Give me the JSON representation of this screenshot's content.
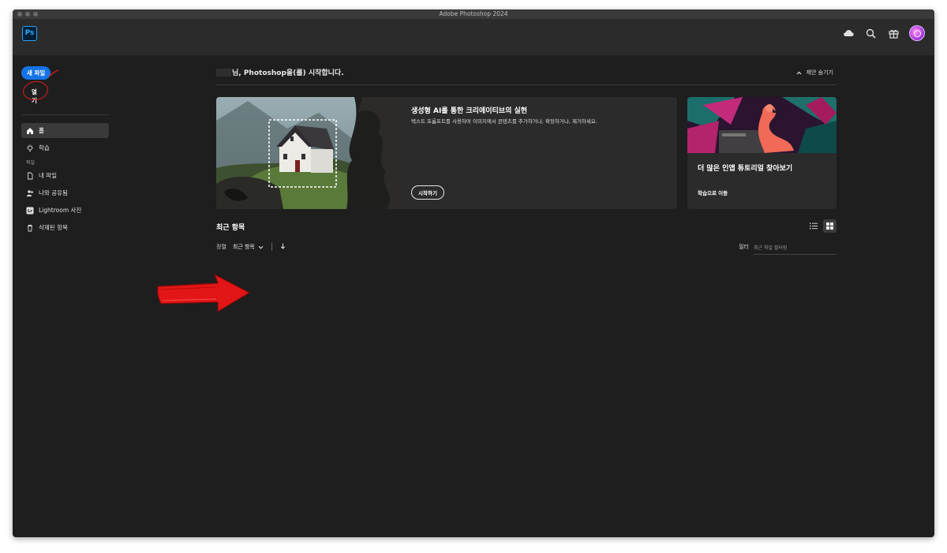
{
  "window": {
    "title": "Adobe Photoshop 2024"
  },
  "app": {
    "logo_text": "Ps"
  },
  "toolbar_icons": [
    "cloud-icon",
    "search-icon",
    "gift-icon",
    "avatar"
  ],
  "sidebar": {
    "new_file": "새 파일",
    "open": "열기",
    "items": [
      {
        "label": "홈",
        "icon": "home-icon",
        "active": true
      },
      {
        "label": "학습",
        "icon": "lightbulb-icon",
        "active": false
      }
    ],
    "section_files": "파일",
    "file_items": [
      {
        "label": "내 파일",
        "icon": "file-icon"
      },
      {
        "label": "나와 공유됨",
        "icon": "shared-users-icon"
      },
      {
        "label": "Lightroom 사진",
        "icon": "lightroom-icon"
      },
      {
        "label": "삭제된 항목",
        "icon": "trash-icon"
      }
    ]
  },
  "main": {
    "greeting_suffix": "님, Photoshop을(를) 시작합니다.",
    "hide_suggestions": "제안 숨기기",
    "card_main": {
      "title": "생성형 AI를 통한 크리에이티브의 실현",
      "description": "텍스트 프롬프트를 사용하여 이미지에서 콘텐츠를 추가하거나, 확장하거나, 제거하세요.",
      "button": "시작하기"
    },
    "card_side": {
      "title": "더 많은 인앱 튜토리얼 찾아보기",
      "link": "학습으로 이동"
    },
    "recent": {
      "title": "최근 항목",
      "sort_label": "정렬",
      "sort_value": "최근 항목",
      "filter_label": "필터",
      "filter_placeholder": "최근 파일 필터링"
    }
  },
  "colors": {
    "accent": "#1473e6",
    "background": "#1e1e1e",
    "annotation": "#e01b1b"
  }
}
